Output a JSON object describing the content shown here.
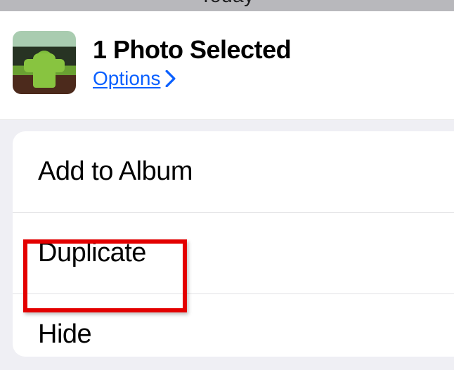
{
  "top_text": "Today",
  "header": {
    "title": "1 Photo Selected",
    "options_label": "Options"
  },
  "actions": {
    "add_to_album": "Add to Album",
    "duplicate": "Duplicate",
    "hide": "Hide"
  }
}
